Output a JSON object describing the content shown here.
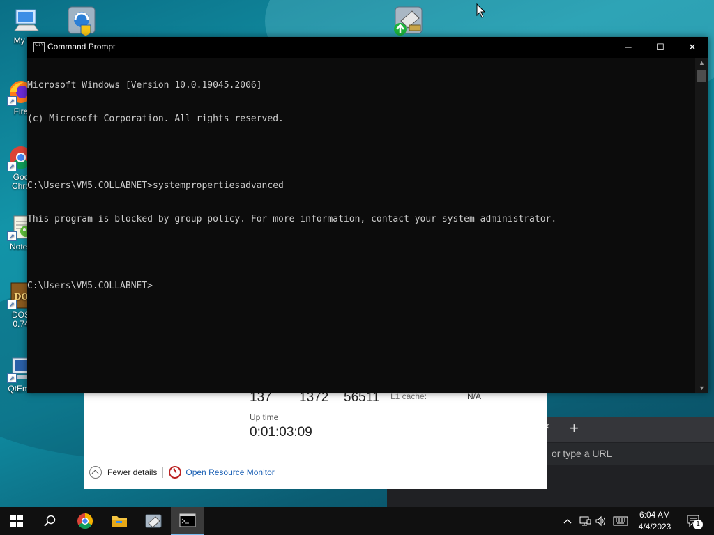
{
  "desktop": {
    "icons": [
      {
        "label": "My Co",
        "icon": "computer-icon"
      },
      {
        "label": "",
        "icon": "network-setup-icon"
      },
      {
        "label": "",
        "icon": "network-transfer-icon"
      },
      {
        "label": "Fire",
        "icon": "firefox-icon"
      },
      {
        "label": "Goo\nChro",
        "icon": "chrome-icon"
      },
      {
        "label": "Notep",
        "icon": "notepad-icon"
      },
      {
        "label": "DOS\n0.74",
        "icon": "dosbox-icon"
      },
      {
        "label": "QtEmu",
        "icon": "qtemu-icon"
      }
    ]
  },
  "task_manager": {
    "values": [
      "137",
      "1372",
      "56511"
    ],
    "l1_label": "L1 cache:",
    "l1_value": "N/A",
    "uptime_label": "Up time",
    "uptime_value": "0:01:03:09",
    "fewer_details": "Fewer details",
    "open_resource_monitor": "Open Resource Monitor"
  },
  "browser": {
    "tab_close": "×",
    "new_tab": "+",
    "address_placeholder": "or type a URL"
  },
  "cmd": {
    "title": "Command Prompt",
    "lines": [
      "Microsoft Windows [Version 10.0.19045.2006]",
      "(c) Microsoft Corporation. All rights reserved.",
      "",
      "C:\\Users\\VM5.COLLABNET>systempropertiesadvanced",
      "This program is blocked by group policy. For more information, contact your system administrator.",
      "",
      "C:\\Users\\VM5.COLLABNET>"
    ],
    "buttons": {
      "minimize": "─",
      "maximize": "☐",
      "close": "✕"
    }
  },
  "taskbar": {
    "time": "6:04 AM",
    "date": "4/4/2023",
    "notification_count": "1",
    "apps": [
      "start-icon",
      "search-icon",
      "chrome-icon",
      "file-explorer-icon",
      "network-tool-icon",
      "command-prompt-icon"
    ]
  },
  "colors": {
    "console_bg": "#0c0c0c",
    "console_text": "#cccccc",
    "taskbar_bg": "#101010",
    "link": "#1a5fb4"
  }
}
